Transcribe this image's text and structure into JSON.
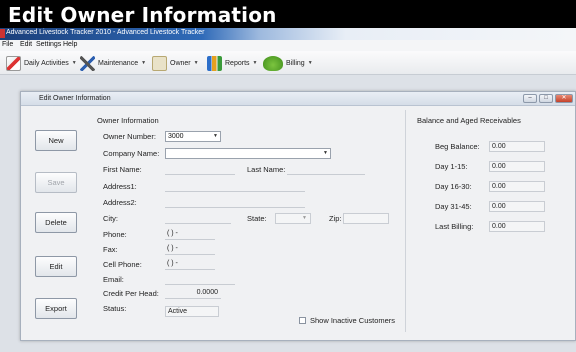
{
  "banner": "Edit Owner Information",
  "app_title": "Advanced Livestock Tracker 2010 - Advanced Livestock Tracker",
  "menu": [
    "File",
    "Edit",
    "Settings",
    "Help"
  ],
  "toolbar": {
    "daily": "Daily Activities",
    "maintenance": "Maintenance",
    "owner": "Owner",
    "reports": "Reports",
    "billing": "Billing"
  },
  "window": {
    "title": "Edit Owner Information",
    "buttons": {
      "new": "New",
      "save": "Save",
      "delete": "Delete",
      "edit": "Edit",
      "export": "Export"
    },
    "owner_section": "Owner Information",
    "labels": {
      "owner_number": "Owner Number:",
      "company_name": "Company Name:",
      "first_name": "First Name:",
      "last_name": "Last Name:",
      "address1": "Address1:",
      "address2": "Address2:",
      "city": "City:",
      "state": "State:",
      "zip": "Zip:",
      "phone": "Phone:",
      "fax": "Fax:",
      "cell_phone": "Cell Phone:",
      "email": "Email:",
      "credit_per_head": "Credit Per Head:",
      "status": "Status:"
    },
    "values": {
      "owner_number": "3000",
      "company_name": "",
      "phone": "( )  -",
      "fax": "( )  -",
      "cell_phone": "( )  -",
      "credit_per_head": "0.0000",
      "status": "Active"
    },
    "show_inactive": "Show Inactive Customers",
    "balance": {
      "title": "Balance and Aged Receivables",
      "beg_balance_label": "Beg Balance:",
      "beg_balance": "0.00",
      "day_1_15_label": "Day 1-15:",
      "day_1_15": "0.00",
      "day_16_30_label": "Day 16-30:",
      "day_16_30": "0.00",
      "day_31_45_label": "Day 31-45:",
      "day_31_45": "0.00",
      "last_billing_label": "Last Billing:",
      "last_billing": "0.00"
    }
  },
  "colors": {
    "banner_bg": "#000000",
    "titlebar": "#2f6ab8",
    "close_button": "#c4412a"
  }
}
